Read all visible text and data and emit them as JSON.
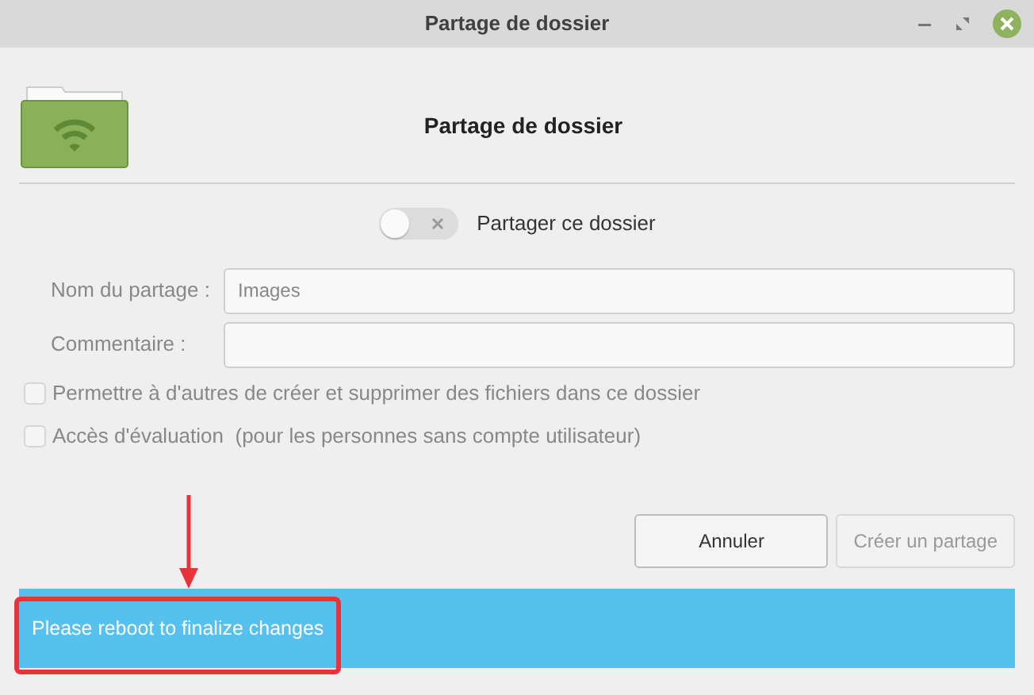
{
  "window": {
    "title": "Partage de dossier"
  },
  "header": {
    "title": "Partage de dossier"
  },
  "share_toggle": {
    "label": "Partager ce dossier",
    "on": false
  },
  "fields": [
    {
      "label": "Nom du partage :",
      "value": "Images",
      "disabled": true
    },
    {
      "label": "Commentaire :",
      "disabled": true
    }
  ],
  "checkboxes": [
    {
      "label": "Permettre à d'autres de créer et supprimer des fichiers dans ce dossier",
      "checked": false,
      "disabled": true
    },
    {
      "label": "Accès d'évaluation",
      "note": "(pour les personnes sans compte utilisateur)",
      "checked": false,
      "disabled": true
    }
  ],
  "buttons": [
    {
      "label": "Annuler",
      "disabled": false
    },
    {
      "label": "Créer un partage",
      "disabled": true
    }
  ],
  "info_bar": {
    "message": "Please reboot to finalize changes"
  },
  "annotations": {
    "highlight_box": true,
    "arrow": true
  }
}
